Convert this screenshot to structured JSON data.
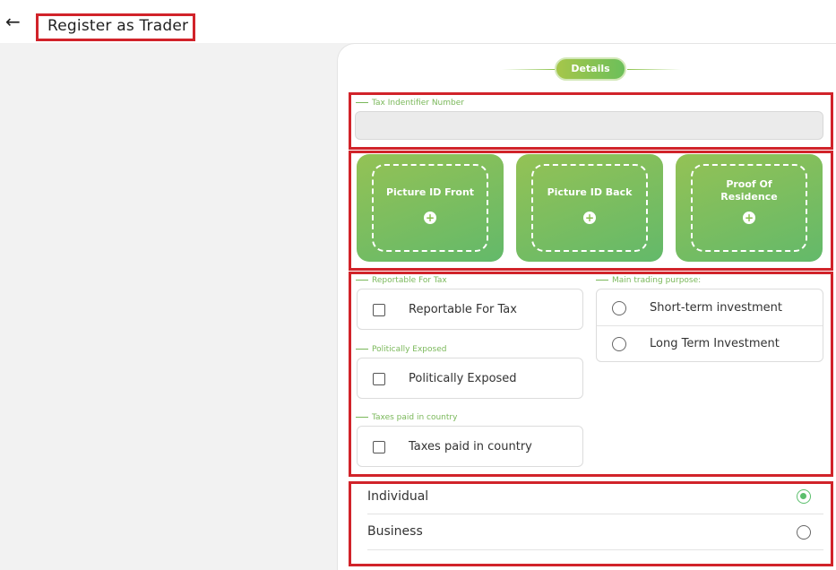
{
  "header": {
    "back_icon": "arrow-left-icon",
    "title": "Register as Trader"
  },
  "step": {
    "label": "Details"
  },
  "tax_id": {
    "legend": "Tax Indentifier Number",
    "value": ""
  },
  "uploads": [
    {
      "label": "Picture ID Front",
      "icon": "plus-circle-icon"
    },
    {
      "label": "Picture ID Back",
      "icon": "plus-circle-icon"
    },
    {
      "label": "Proof Of Residence",
      "icon": "plus-circle-icon"
    }
  ],
  "checks": [
    {
      "legend": "Reportable For Tax",
      "label": "Reportable For Tax",
      "checked": false
    },
    {
      "legend": "Politically Exposed",
      "label": "Politically Exposed",
      "checked": false
    },
    {
      "legend": "Taxes paid in country",
      "label": "Taxes paid in country",
      "checked": false
    }
  ],
  "trading_purpose": {
    "legend": "Main trading purpose:",
    "options": [
      {
        "label": "Short-term investment",
        "selected": false
      },
      {
        "label": "Long Term Investment",
        "selected": false
      }
    ]
  },
  "account_type": {
    "options": [
      {
        "label": "Individual",
        "selected": true
      },
      {
        "label": "Business",
        "selected": false
      }
    ]
  },
  "colors": {
    "accent_green": "#6cbf5a",
    "highlight_red": "#d1232a"
  }
}
